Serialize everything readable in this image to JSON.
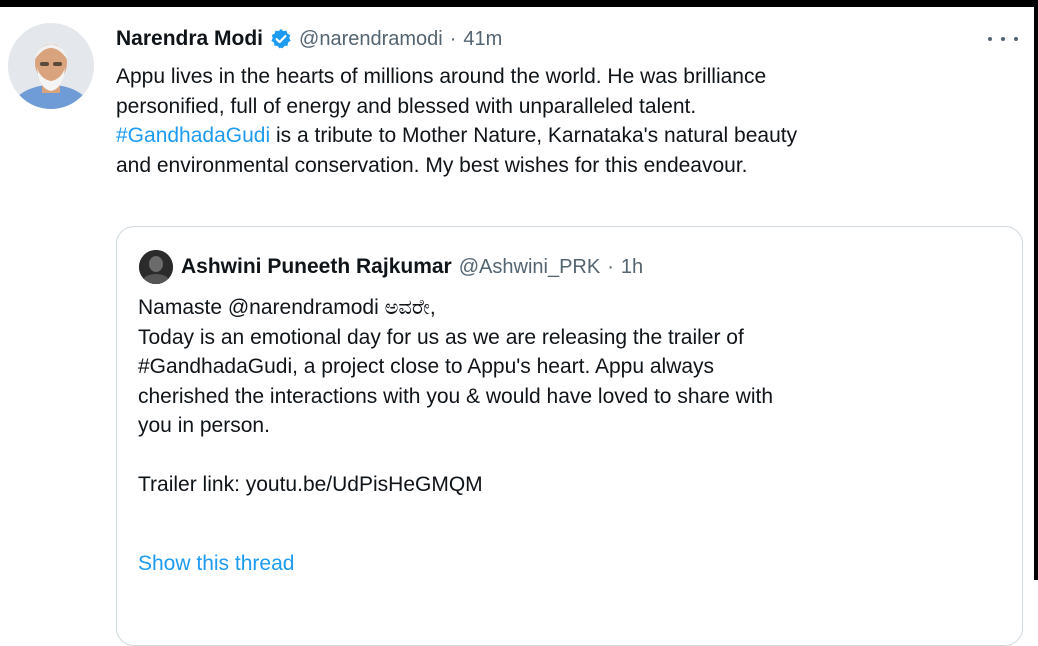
{
  "tweet": {
    "author_name": "Narendra Modi",
    "author_handle": "@narendramodi",
    "separator": "·",
    "time": "41m",
    "verified_icon": "verified-badge-icon",
    "more_icon": "more-options-icon",
    "line1": "Appu lives in the hearts of millions around the world. He was brilliance",
    "line2": "personified, full of energy and blessed with unparalleled talent.",
    "hashtag": "#GandhadaGudi",
    "line3_rest": " is a tribute to Mother Nature, Karnataka's natural beauty",
    "line4": "and environmental conservation. My best wishes for this endeavour."
  },
  "quoted_tweet": {
    "author_name": "Ashwini Puneeth Rajkumar",
    "author_handle": "@Ashwini_PRK",
    "separator": "·",
    "time": "1h",
    "lines": [
      "Namaste @narendramodi ಅವರೇ,",
      "Today is an emotional day for us as we are releasing the trailer of",
      "#GandhadaGudi, a project close to Appu's heart. Appu always",
      "cherished the interactions with you & would have loved to share with",
      "you in person.",
      "",
      "Trailer link: youtu.be/UdPisHeGMQM"
    ],
    "show_thread": "Show this thread"
  },
  "colors": {
    "link": "#1d9bf0",
    "secondary_text": "#536471",
    "primary_text": "#0f1419",
    "border": "#cfd9de"
  }
}
